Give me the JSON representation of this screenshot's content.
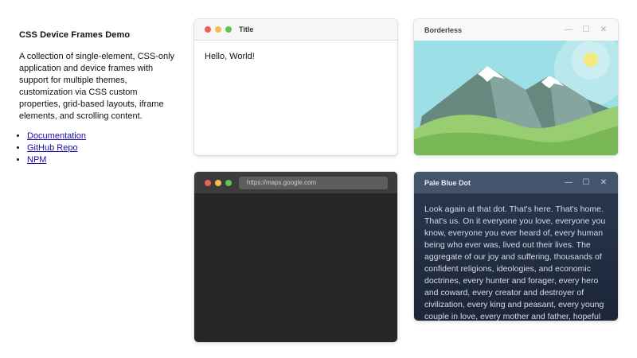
{
  "sidebar": {
    "title": "CSS Device Frames Demo",
    "description": "A collection of single-element, CSS-only application and device frames with support for multiple themes, customization via CSS custom properties, grid-based layouts, iframe elements, and scrolling content.",
    "links": [
      "Documentation",
      "GitHub Repo",
      "NPM"
    ]
  },
  "frame_mac_light": {
    "title": "Title",
    "content": "Hello, World!",
    "dot_colors": [
      "#ee5f5b",
      "#f5bd4f",
      "#5fc454"
    ]
  },
  "frame_borderless": {
    "title": "Borderless",
    "controls": {
      "minimize": "—",
      "maximize": "☐",
      "close": "✕"
    }
  },
  "frame_browser_dark": {
    "url": "https://maps.google.com",
    "dot_colors": [
      "#ee5f5b",
      "#f5bd4f",
      "#5fc454"
    ]
  },
  "frame_pale_blue_dot": {
    "title": "Pale Blue Dot",
    "controls": {
      "minimize": "—",
      "maximize": "☐",
      "close": "✕"
    },
    "content": "Look again at that dot. That's here. That's home. That's us. On it everyone you love, everyone you know, everyone you ever heard of, every human being who ever was, lived out their lives. The aggregate of our joy and suffering, thousands of confident religions, ideologies, and economic doctrines, every hunter and forager, every hero and coward, every creator and destroyer of civilization, every king and peasant, every young couple in love, every mother and father, hopeful child,"
  }
}
